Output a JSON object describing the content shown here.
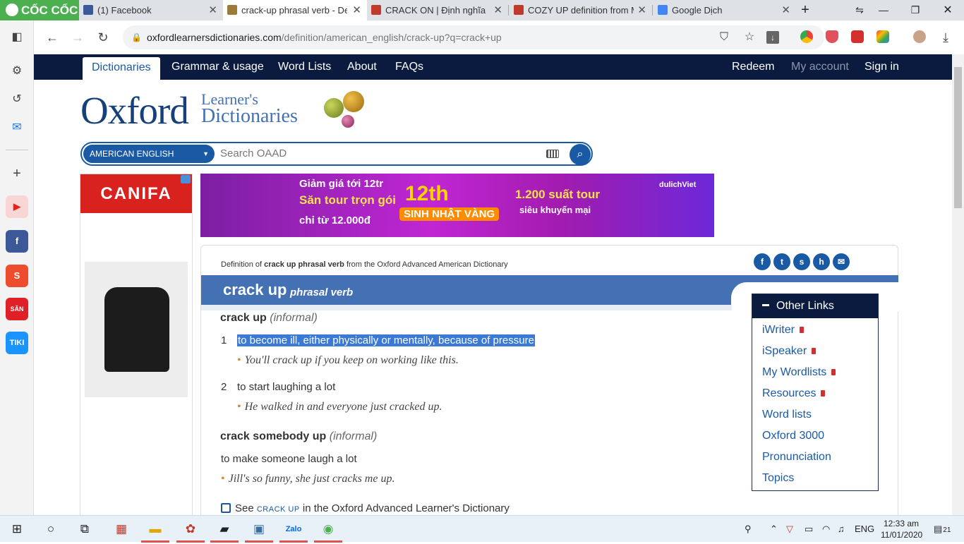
{
  "browser": {
    "brand": "CỐC CỐC",
    "tabs": [
      {
        "title": "(1) Facebook",
        "active": false,
        "favicon_color": "#3b5998"
      },
      {
        "title": "crack-up phrasal verb - Def",
        "active": true,
        "favicon_color": "#9c7b3a"
      },
      {
        "title": "CRACK ON | Định nghĩa tro",
        "active": false,
        "favicon_color": "#c0392b"
      },
      {
        "title": "COZY UP definition from M",
        "active": false,
        "favicon_color": "#c0392b"
      },
      {
        "title": "Google Dịch",
        "active": false,
        "favicon_color": "#4285f4"
      }
    ],
    "url_host": "oxfordlearnersdictionaries.com",
    "url_path": "/definition/american_english/crack-up?q=crack+up"
  },
  "site_nav": {
    "left": [
      "Dictionaries",
      "Grammar & usage",
      "Word Lists",
      "About",
      "FAQs"
    ],
    "right": [
      "Redeem",
      "My account",
      "Sign in"
    ]
  },
  "logo": {
    "main": "Oxford",
    "line1": "Learner's",
    "line2": "Dictionaries"
  },
  "search": {
    "dictionary": "AMERICAN ENGLISH",
    "placeholder": "Search OAAD"
  },
  "ads": {
    "left_brand": "CANIFA",
    "banner": {
      "line1": "Giảm giá tới 12tr",
      "line2": "Săn tour trọn gói",
      "line3": "chỉ từ 12.000đ",
      "badge": "12th",
      "ribbon": "SINH NHẬT VÀNG",
      "offer1": "1.200 suất tour",
      "offer2": "siêu khuyến mại",
      "sponsor": "dulichViet"
    }
  },
  "entry": {
    "source_prefix": "Definition of ",
    "source_bold": "crack up phrasal verb",
    "source_suffix": " from the Oxford Advanced American Dictionary",
    "headword": "crack up",
    "pos": "phrasal verb",
    "sense_groups": [
      {
        "phrase": "crack up",
        "label": "informal",
        "senses": [
          {
            "num": "1",
            "def": "to become ill, either physically or mentally, because of pressure",
            "example": "You'll crack up if you keep on working like this.",
            "highlighted": true
          },
          {
            "num": "2",
            "def": "to start laughing a lot",
            "example": "He walked in and everyone just cracked up.",
            "highlighted": false
          }
        ]
      },
      {
        "phrase": "crack somebody up",
        "label": "informal",
        "senses": [
          {
            "num": "",
            "def": "to make someone laugh a lot",
            "example": "Jill's so funny, she just cracks me up.",
            "highlighted": false
          }
        ]
      }
    ],
    "see_also": {
      "prefix": "See ",
      "term": "CRACK UP",
      "suffix": " in the Oxford Advanced Learner's Dictionary"
    }
  },
  "other_links": {
    "title": "Other Links",
    "items": [
      {
        "label": "iWriter",
        "locked": true
      },
      {
        "label": "iSpeaker",
        "locked": true
      },
      {
        "label": "My Wordlists",
        "locked": true
      },
      {
        "label": "Resources",
        "locked": true
      },
      {
        "label": "Word lists",
        "locked": false
      },
      {
        "label": "Oxford 3000",
        "locked": false
      },
      {
        "label": "Pronunciation",
        "locked": false
      },
      {
        "label": "Topics",
        "locked": false
      }
    ]
  },
  "taskbar": {
    "language": "ENG",
    "time": "12:33 am",
    "date": "11/01/2020",
    "notifications": "21"
  },
  "colors": {
    "oxford_blue": "#1a5aa5",
    "nav_dark": "#0b1a3f",
    "headword_bar": "#4471b3",
    "highlight": "#3a79d6"
  }
}
